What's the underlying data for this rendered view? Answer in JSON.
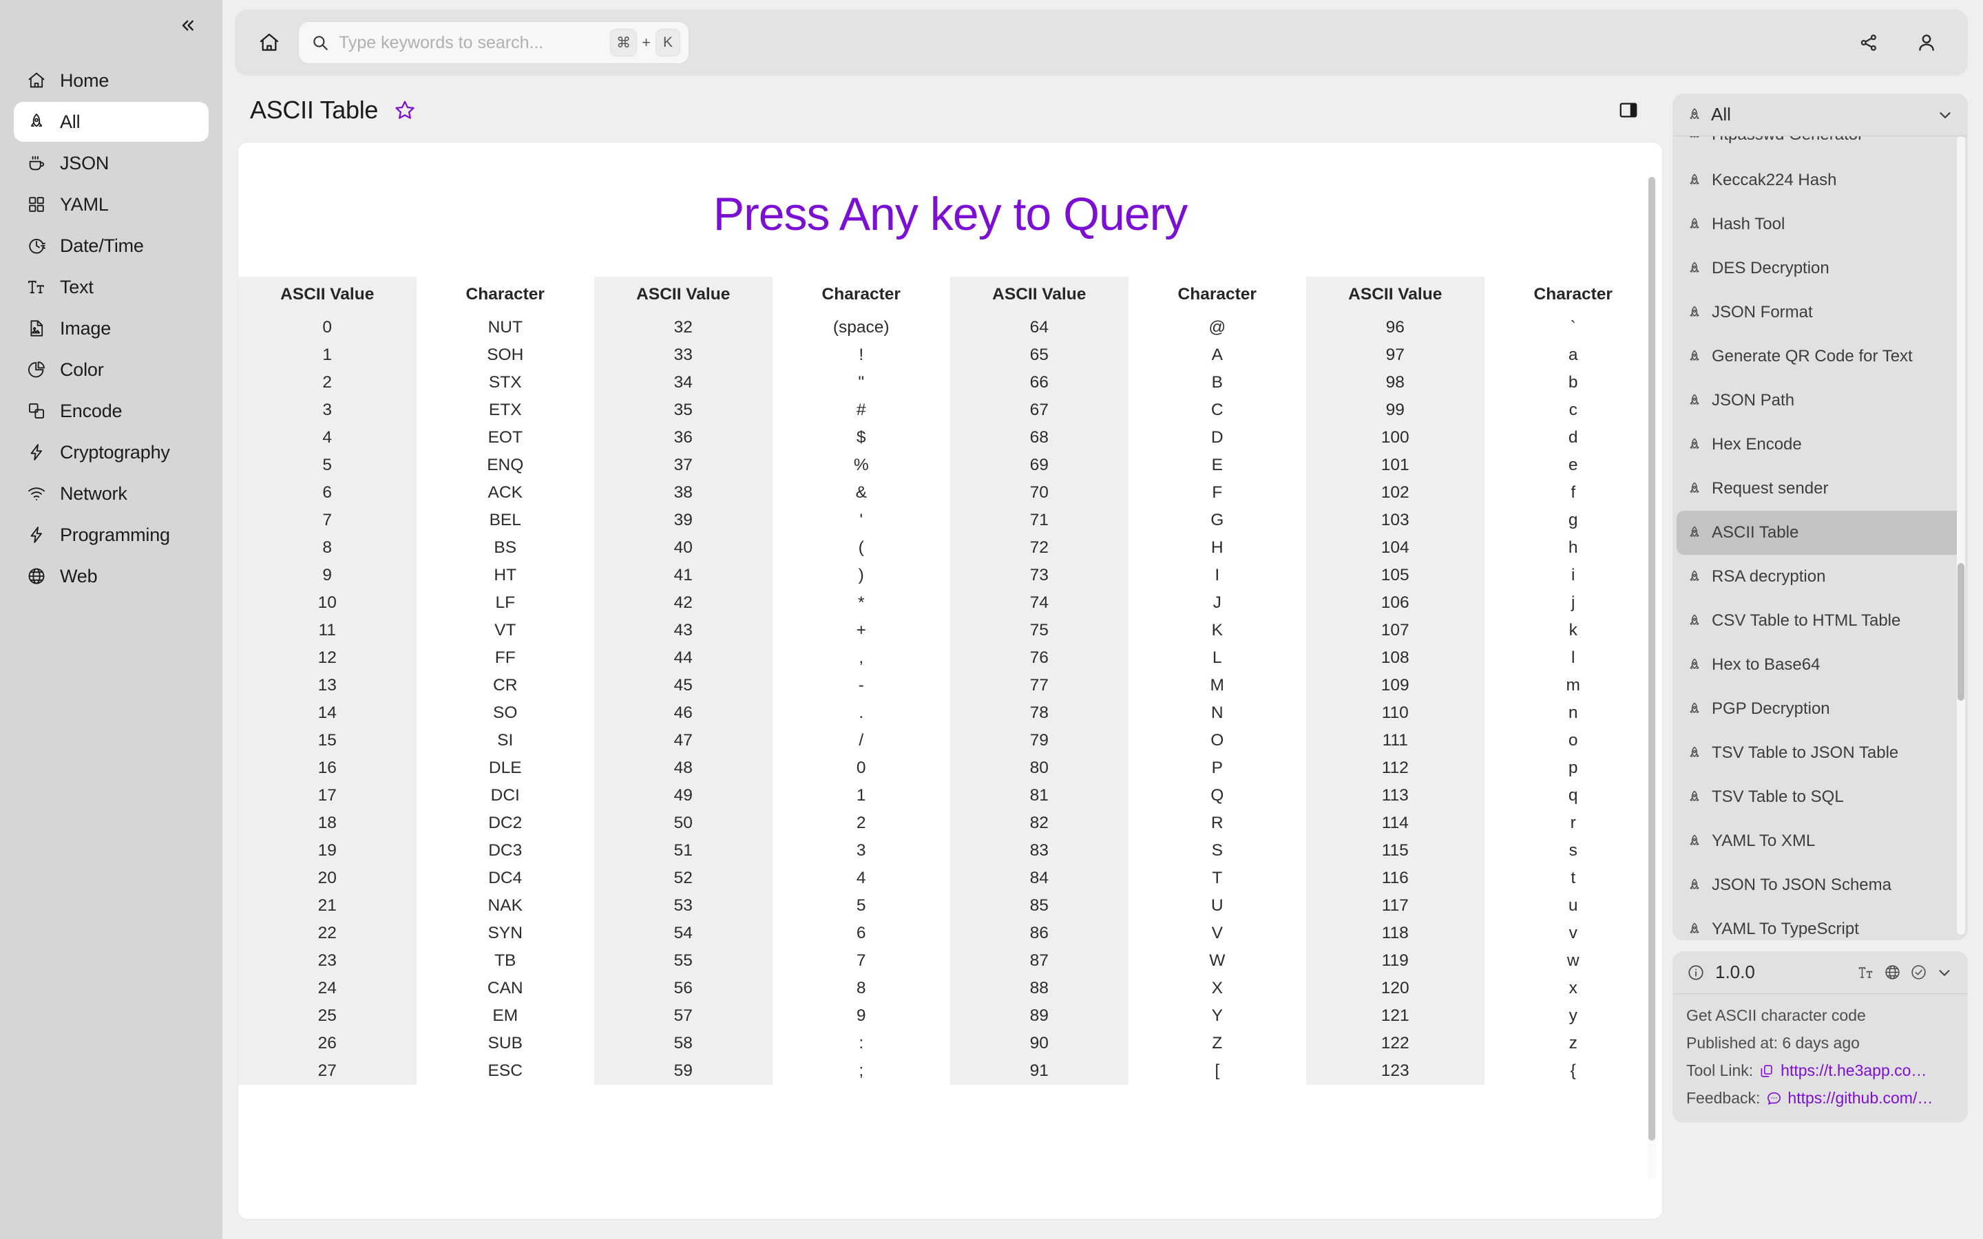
{
  "sidebar": {
    "collapse_icon": "chevrons-left-icon",
    "items": [
      {
        "label": "Home",
        "icon": "home-icon",
        "active": false
      },
      {
        "label": "All",
        "icon": "rocket-icon",
        "active": true
      },
      {
        "label": "JSON",
        "icon": "coffee-cup-icon",
        "active": false
      },
      {
        "label": "YAML",
        "icon": "grid-icon",
        "active": false
      },
      {
        "label": "Date/Time",
        "icon": "clock-icon",
        "active": false
      },
      {
        "label": "Text",
        "icon": "text-format-icon",
        "active": false
      },
      {
        "label": "Image",
        "icon": "image-file-icon",
        "active": false
      },
      {
        "label": "Color",
        "icon": "pie-chart-icon",
        "active": false
      },
      {
        "label": "Encode",
        "icon": "layers-icon",
        "active": false
      },
      {
        "label": "Cryptography",
        "icon": "lightning-icon",
        "active": false
      },
      {
        "label": "Network",
        "icon": "wifi-icon",
        "active": false
      },
      {
        "label": "Programming",
        "icon": "lightning-icon",
        "active": false
      },
      {
        "label": "Web",
        "icon": "globe-icon",
        "active": false
      }
    ]
  },
  "topbar": {
    "home_icon": "home-icon",
    "search": {
      "icon": "search-icon",
      "placeholder": "Type keywords to search...",
      "value": "",
      "shortcut_key": "⌘",
      "shortcut_plus": "+",
      "shortcut_letter": "K"
    },
    "share_icon": "share-icon",
    "account_icon": "user-account-icon"
  },
  "page": {
    "title": "ASCII Table",
    "favorite_icon": "star-outline-icon",
    "favorite_color": "#7b0fd4",
    "panel_toggle_icon": "toggle-right-panel-icon"
  },
  "main": {
    "hero_text": "Press Any key to Query",
    "hero_color": "#7b0fd4"
  },
  "table": {
    "headers": [
      "ASCII Value",
      "Character",
      "ASCII Value",
      "Character",
      "ASCII Value",
      "Character",
      "ASCII Value",
      "Character"
    ],
    "rows": [
      [
        "0",
        "NUT",
        "32",
        "(space)",
        "64",
        "@",
        "96",
        "`"
      ],
      [
        "1",
        "SOH",
        "33",
        "!",
        "65",
        "A",
        "97",
        "a"
      ],
      [
        "2",
        "STX",
        "34",
        "\"",
        "66",
        "B",
        "98",
        "b"
      ],
      [
        "3",
        "ETX",
        "35",
        "#",
        "67",
        "C",
        "99",
        "c"
      ],
      [
        "4",
        "EOT",
        "36",
        "$",
        "68",
        "D",
        "100",
        "d"
      ],
      [
        "5",
        "ENQ",
        "37",
        "%",
        "69",
        "E",
        "101",
        "e"
      ],
      [
        "6",
        "ACK",
        "38",
        "&",
        "70",
        "F",
        "102",
        "f"
      ],
      [
        "7",
        "BEL",
        "39",
        "'",
        "71",
        "G",
        "103",
        "g"
      ],
      [
        "8",
        "BS",
        "40",
        "(",
        "72",
        "H",
        "104",
        "h"
      ],
      [
        "9",
        "HT",
        "41",
        ")",
        "73",
        "I",
        "105",
        "i"
      ],
      [
        "10",
        "LF",
        "42",
        "*",
        "74",
        "J",
        "106",
        "j"
      ],
      [
        "11",
        "VT",
        "43",
        "+",
        "75",
        "K",
        "107",
        "k"
      ],
      [
        "12",
        "FF",
        "44",
        ",",
        "76",
        "L",
        "108",
        "l"
      ],
      [
        "13",
        "CR",
        "45",
        "-",
        "77",
        "M",
        "109",
        "m"
      ],
      [
        "14",
        "SO",
        "46",
        ".",
        "78",
        "N",
        "110",
        "n"
      ],
      [
        "15",
        "SI",
        "47",
        "/",
        "79",
        "O",
        "111",
        "o"
      ],
      [
        "16",
        "DLE",
        "48",
        "0",
        "80",
        "P",
        "112",
        "p"
      ],
      [
        "17",
        "DCI",
        "49",
        "1",
        "81",
        "Q",
        "113",
        "q"
      ],
      [
        "18",
        "DC2",
        "50",
        "2",
        "82",
        "R",
        "114",
        "r"
      ],
      [
        "19",
        "DC3",
        "51",
        "3",
        "83",
        "S",
        "115",
        "s"
      ],
      [
        "20",
        "DC4",
        "52",
        "4",
        "84",
        "T",
        "116",
        "t"
      ],
      [
        "21",
        "NAK",
        "53",
        "5",
        "85",
        "U",
        "117",
        "u"
      ],
      [
        "22",
        "SYN",
        "54",
        "6",
        "86",
        "V",
        "118",
        "v"
      ],
      [
        "23",
        "TB",
        "55",
        "7",
        "87",
        "W",
        "119",
        "w"
      ],
      [
        "24",
        "CAN",
        "56",
        "8",
        "88",
        "X",
        "120",
        "x"
      ],
      [
        "25",
        "EM",
        "57",
        "9",
        "89",
        "Y",
        "121",
        "y"
      ],
      [
        "26",
        "SUB",
        "58",
        ":",
        "90",
        "Z",
        "122",
        "z"
      ],
      [
        "27",
        "ESC",
        "59",
        ";",
        "91",
        "[",
        "123",
        "{"
      ]
    ]
  },
  "right_panel": {
    "filter": {
      "label": "All",
      "icon": "rocket-icon",
      "chevron": "chevron-down-icon"
    },
    "tools": [
      {
        "label": "Htpasswd Generator",
        "active": false,
        "clipped": true
      },
      {
        "label": "Keccak224 Hash",
        "active": false
      },
      {
        "label": "Hash Tool",
        "active": false
      },
      {
        "label": "DES Decryption",
        "active": false
      },
      {
        "label": "JSON Format",
        "active": false
      },
      {
        "label": "Generate QR Code for Text",
        "active": false
      },
      {
        "label": "JSON Path",
        "active": false
      },
      {
        "label": "Hex Encode",
        "active": false
      },
      {
        "label": "Request sender",
        "active": false
      },
      {
        "label": "ASCII Table",
        "active": true
      },
      {
        "label": "RSA decryption",
        "active": false
      },
      {
        "label": "CSV Table to HTML Table",
        "active": false
      },
      {
        "label": "Hex to Base64",
        "active": false
      },
      {
        "label": "PGP Decryption",
        "active": false
      },
      {
        "label": "TSV Table to JSON Table",
        "active": false
      },
      {
        "label": "TSV Table to SQL",
        "active": false
      },
      {
        "label": "YAML To XML",
        "active": false
      },
      {
        "label": "JSON To JSON Schema",
        "active": false
      },
      {
        "label": "YAML To TypeScript",
        "active": false,
        "clipped_bottom": true
      }
    ],
    "info": {
      "version": "1.0.0",
      "info_icon": "info-circle-icon",
      "icons": [
        "text-format-icon",
        "globe-icon",
        "check-circle-icon",
        "chevron-down-icon"
      ],
      "description": "Get ASCII character code",
      "published_label": "Published at: 6 days ago",
      "tool_link_label": "Tool Link:",
      "tool_link_value": "https://t.he3app.co…",
      "feedback_label": "Feedback:",
      "feedback_value": "https://github.com/…",
      "link_color": "#7b0fd4"
    }
  }
}
